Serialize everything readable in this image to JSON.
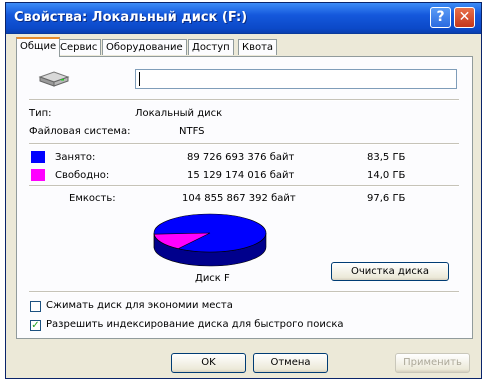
{
  "window": {
    "title": "Свойства: Локальный диск (F:)",
    "help_glyph": "?",
    "close_glyph": "✕"
  },
  "tabs": [
    {
      "label": "Общие",
      "active": true
    },
    {
      "label": "Сервис",
      "active": false
    },
    {
      "label": "Оборудование",
      "active": false
    },
    {
      "label": "Доступ",
      "active": false
    },
    {
      "label": "Квота",
      "active": false
    }
  ],
  "general": {
    "drive_icon": "drive-icon",
    "name_value": "",
    "type_label": "Тип:",
    "type_value": "Локальный диск",
    "fs_label": "Файловая система:",
    "fs_value": "NTFS",
    "used_label": "Занято:",
    "used_bytes": "89 726 693 376 байт",
    "used_gb": "83,5 ГБ",
    "free_label": "Свободно:",
    "free_bytes": "15 129 174 016 байт",
    "free_gb": "14,0 ГБ",
    "capacity_label": "Емкость:",
    "capacity_bytes": "104 855 867 392 байт",
    "capacity_gb": "97,6 ГБ",
    "disk_label": "Диск F",
    "cleanup_button": "Очистка диска",
    "compress_label": "Сжимать диск для экономии места",
    "compress_checked": false,
    "index_label": "Разрешить индексирование диска для быстрого поиска",
    "index_checked": true,
    "used_fraction": 0.8557,
    "colors": {
      "used": "#0000ff",
      "free": "#ff00ff"
    }
  },
  "footer": {
    "ok": "OK",
    "cancel": "Отмена",
    "apply": "Применить"
  }
}
